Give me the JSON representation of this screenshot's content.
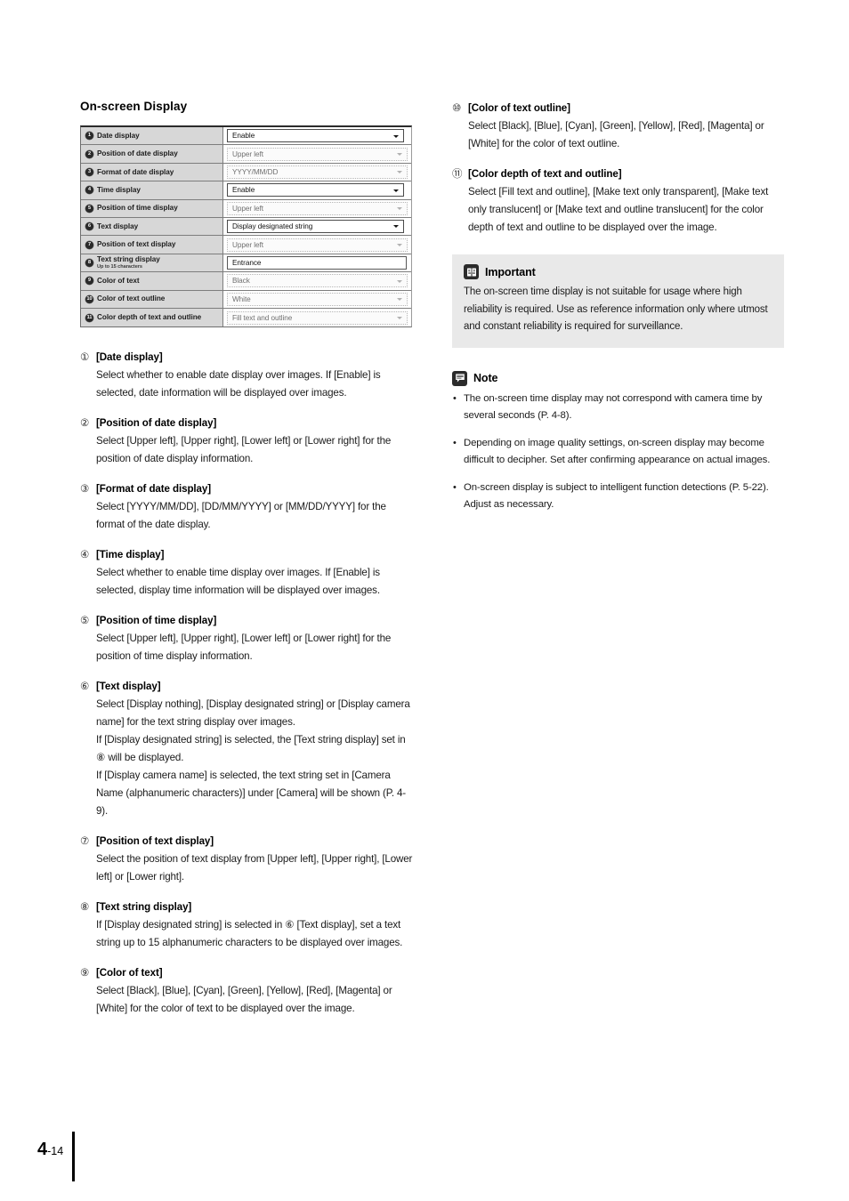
{
  "page": {
    "footer": {
      "chapter": "4",
      "page_suffix": "-14"
    }
  },
  "left": {
    "section_title": "On-screen Display",
    "screenshot": {
      "rows": [
        {
          "num": "1",
          "label": "Date display",
          "sublabel": "",
          "value": "Enable",
          "control": "select",
          "state": "active"
        },
        {
          "num": "2",
          "label": "Position of date display",
          "sublabel": "",
          "value": "Upper left",
          "control": "select",
          "state": "dimmed"
        },
        {
          "num": "3",
          "label": "Format of date display",
          "sublabel": "",
          "value": "YYYY/MM/DD",
          "control": "select",
          "state": "dimmed"
        },
        {
          "num": "4",
          "label": "Time display",
          "sublabel": "",
          "value": "Enable",
          "control": "select",
          "state": "active"
        },
        {
          "num": "5",
          "label": "Position of time display",
          "sublabel": "",
          "value": "Upper left",
          "control": "select",
          "state": "dimmed"
        },
        {
          "num": "6",
          "label": "Text display",
          "sublabel": "",
          "value": "Display designated string",
          "control": "select",
          "state": "active"
        },
        {
          "num": "7",
          "label": "Position of text display",
          "sublabel": "",
          "value": "Upper left",
          "control": "select",
          "state": "dimmed"
        },
        {
          "num": "8",
          "label": "Text string display",
          "sublabel": "Up to 15 characters",
          "value": "Entrance",
          "control": "textbox",
          "state": "active"
        },
        {
          "num": "9",
          "label": "Color of text",
          "sublabel": "",
          "value": "Black",
          "control": "select",
          "state": "dimmed"
        },
        {
          "num": "10",
          "label": "Color of text outline",
          "sublabel": "",
          "value": "White",
          "control": "select",
          "state": "dimmed"
        },
        {
          "num": "11",
          "label": "Color depth of text and outline",
          "sublabel": "",
          "value": "Fill text and outline",
          "control": "select",
          "state": "dimmed"
        }
      ]
    },
    "items": [
      {
        "num": "①",
        "title": "[Date display]",
        "body": "Select whether to enable date display over images. If [Enable] is selected, date information will be displayed over images."
      },
      {
        "num": "②",
        "title": "[Position of date display]",
        "body": "Select [Upper left], [Upper right], [Lower left] or [Lower right] for the position of date display information."
      },
      {
        "num": "③",
        "title": "[Format of date display]",
        "body": "Select [YYYY/MM/DD], [DD/MM/YYYY] or [MM/DD/YYYY] for the format of the date display."
      },
      {
        "num": "④",
        "title": "[Time display]",
        "body": "Select whether to enable time display over images. If [Enable] is selected, display time information will be displayed over images."
      },
      {
        "num": "⑤",
        "title": "[Position of time display]",
        "body": "Select [Upper left], [Upper right], [Lower left] or [Lower right] for the position of time display information."
      },
      {
        "num": "⑥",
        "title": "[Text display]",
        "body": "Select [Display nothing], [Display designated string] or [Display camera name] for the text string display over images.\nIf [Display designated string] is selected, the [Text string display] set in ⑧ will be displayed.\nIf [Display camera name] is selected, the text string set in [Camera Name (alphanumeric characters)] under [Camera] will be shown (P. 4-9)."
      },
      {
        "num": "⑦",
        "title": "[Position of text display]",
        "body": "Select the position of text display from [Upper left], [Upper right], [Lower left] or [Lower right]."
      },
      {
        "num": "⑧",
        "title": "[Text string display]",
        "body": "If [Display designated string] is selected in ⑥ [Text display], set a text string up to 15 alphanumeric characters to be displayed over images."
      },
      {
        "num": "⑨",
        "title": "[Color of text]",
        "body": "Select [Black], [Blue], [Cyan], [Green], [Yellow], [Red], [Magenta] or [White] for the color of text to be displayed over the image."
      }
    ]
  },
  "right": {
    "items": [
      {
        "num": "⑩",
        "title": "[Color of text outline]",
        "body": "Select [Black], [Blue], [Cyan], [Green], [Yellow], [Red], [Magenta] or [White] for the color of text outline."
      },
      {
        "num": "⑪",
        "title": "[Color depth of text and outline]",
        "body": "Select [Fill text and outline], [Make text only transparent], [Make text only translucent] or [Make text and outline translucent] for the color depth of text and outline to be displayed over the image."
      }
    ],
    "important": {
      "title": "Important",
      "body": "The on-screen time display is not suitable for usage where high reliability is required. Use as reference information only where utmost and constant reliability is required for surveillance."
    },
    "note": {
      "title": "Note",
      "bullet": "•",
      "items": [
        "The on-screen time display may not correspond with camera time by several seconds (P. 4-8).",
        "Depending on image quality settings, on-screen display may become difficult to decipher. Set after confirming appearance on actual images.",
        "On-screen display is subject to intelligent function detections (P. 5-22). Adjust as necessary."
      ]
    }
  },
  "colors": {
    "label_bg": "#d7d7d7",
    "callout_bg": "#e9e9e9",
    "icon_bg": "#2b2b2b",
    "text": "#1b1b1b"
  }
}
